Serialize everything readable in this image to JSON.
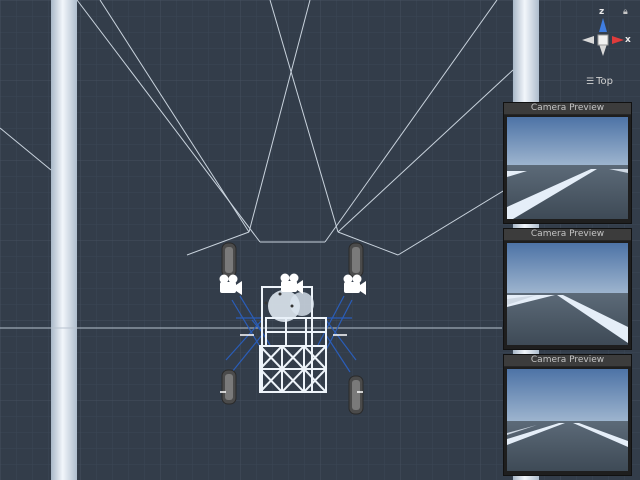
{
  "scene_view": {
    "orientation_label": "Top",
    "gizmo": {
      "axis_up": "z",
      "axis_right": "x",
      "lock_icon": "lock-icon",
      "menu_icon": "hamburger-icon"
    }
  },
  "camera_previews": [
    {
      "title": "Camera Preview"
    },
    {
      "title": "Camera Preview"
    },
    {
      "title": "Camera Preview"
    }
  ],
  "colors": {
    "background": "#333d4a",
    "grid": "#3e4a5a",
    "pillar": "#dfe8f3",
    "wire": "#c8d2dc",
    "robot": "#e8f0f8",
    "sky": "#5a7fb0"
  }
}
